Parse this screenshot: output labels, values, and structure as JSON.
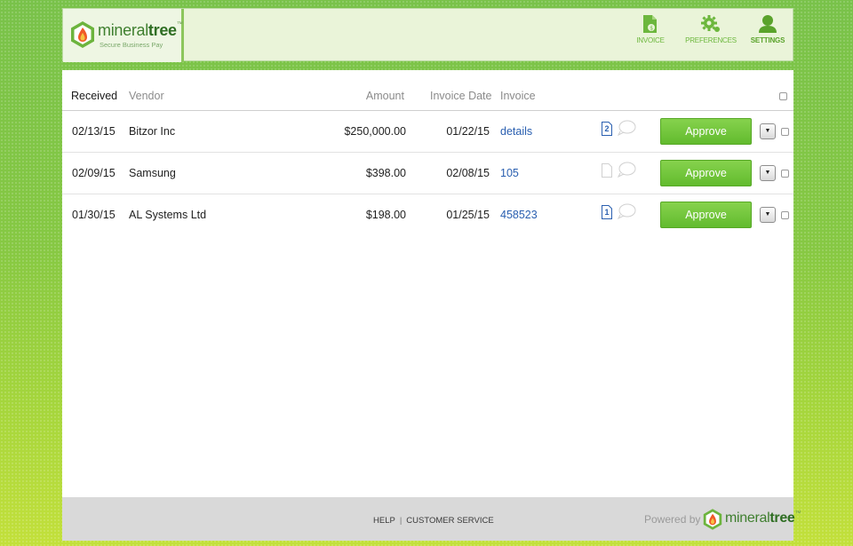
{
  "brand": {
    "name_part1": "mineral",
    "name_part2": "tree",
    "tm": "™",
    "tagline": "Secure Business Pay"
  },
  "nav": {
    "invoice_label": "INVOICE",
    "preferences_label": "PREFERENCES",
    "settings_label": "SETTINGS"
  },
  "table": {
    "headers": {
      "received": "Received",
      "vendor": "Vendor",
      "amount": "Amount",
      "invoice_date": "Invoice Date",
      "invoice": "Invoice"
    },
    "rows": [
      {
        "received": "02/13/15",
        "vendor": "Bitzor Inc",
        "amount": "$250,000.00",
        "invoice_date": "01/22/15",
        "invoice": "details",
        "attachments": "2",
        "action": "Approve"
      },
      {
        "received": "02/09/15",
        "vendor": "Samsung",
        "amount": "$398.00",
        "invoice_date": "02/08/15",
        "invoice": "105",
        "attachments": "",
        "action": "Approve"
      },
      {
        "received": "01/30/15",
        "vendor": "AL Systems Ltd",
        "amount": "$198.00",
        "invoice_date": "01/25/15",
        "invoice": "458523",
        "attachments": "1",
        "action": "Approve"
      }
    ]
  },
  "footer": {
    "help": "HELP",
    "separator": "|",
    "customer_service": "CUSTOMER SERVICE",
    "powered_by": "Powered by"
  },
  "colors": {
    "accent_green": "#62bb2e",
    "link_blue": "#2a5fb0",
    "header_bg": "#eaf4d9",
    "footer_bg": "#d9d9d9"
  },
  "icons": {
    "invoice": "invoice-document-icon",
    "preferences": "gear-icon",
    "settings": "user-icon",
    "attachment": "document-icon",
    "comment": "speech-bubble-icon",
    "dropdown": "caret-down-icon"
  }
}
